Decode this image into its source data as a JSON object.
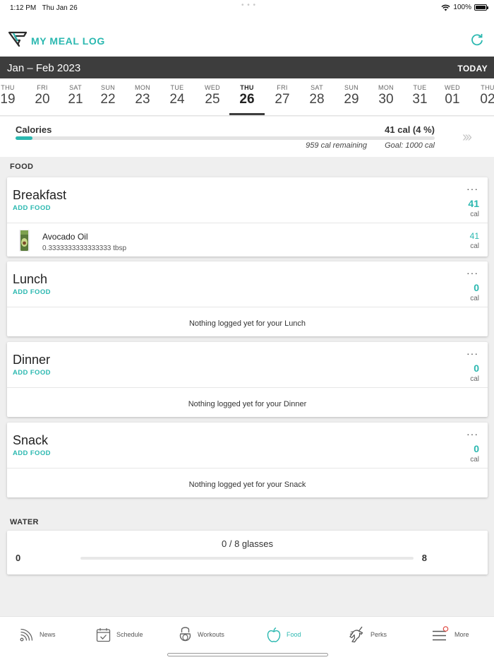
{
  "status_bar": {
    "time": "1:12 PM",
    "date": "Thu Jan 26",
    "battery": "100%"
  },
  "header": {
    "title": "MY MEAL LOG",
    "logo_icon": "brand-logo-icon",
    "refresh_icon": "refresh-icon"
  },
  "calendar": {
    "month_range": "Jan – Feb 2023",
    "today_label": "TODAY",
    "days": [
      {
        "dow": "THU",
        "num": "19"
      },
      {
        "dow": "FRI",
        "num": "20"
      },
      {
        "dow": "SAT",
        "num": "21"
      },
      {
        "dow": "SUN",
        "num": "22"
      },
      {
        "dow": "MON",
        "num": "23"
      },
      {
        "dow": "TUE",
        "num": "24"
      },
      {
        "dow": "WED",
        "num": "25"
      },
      {
        "dow": "THU",
        "num": "26"
      },
      {
        "dow": "FRI",
        "num": "27"
      },
      {
        "dow": "SAT",
        "num": "28"
      },
      {
        "dow": "SUN",
        "num": "29"
      },
      {
        "dow": "MON",
        "num": "30"
      },
      {
        "dow": "TUE",
        "num": "31"
      },
      {
        "dow": "WED",
        "num": "01"
      },
      {
        "dow": "THU",
        "num": "02"
      }
    ],
    "selected_index": 7
  },
  "calories": {
    "label": "Calories",
    "value": "41 cal (4 %)",
    "progress_fraction": 0.041,
    "remaining": "959 cal remaining",
    "goal": "Goal: 1000 cal"
  },
  "food_section": {
    "title": "FOOD",
    "add_food_label": "ADD FOOD",
    "more_label": "···",
    "cal_unit": "cal",
    "meals": [
      {
        "name": "Breakfast",
        "cal": "41",
        "items": [
          {
            "name": "Avocado Oil",
            "qty": "0.3333333333333333 tbsp",
            "cal": "41"
          }
        ]
      },
      {
        "name": "Lunch",
        "cal": "0",
        "empty": "Nothing logged yet for your Lunch"
      },
      {
        "name": "Dinner",
        "cal": "0",
        "empty": "Nothing logged yet for your Dinner"
      },
      {
        "name": "Snack",
        "cal": "0",
        "empty": "Nothing logged yet for your Snack"
      }
    ]
  },
  "water": {
    "title": "WATER",
    "glasses": "0 / 8 glasses",
    "min": "0",
    "max": "8",
    "progress_fraction": 0
  },
  "tabs": [
    {
      "label": "News",
      "icon": "news-icon"
    },
    {
      "label": "Schedule",
      "icon": "calendar-icon"
    },
    {
      "label": "Workouts",
      "icon": "kettlebell-icon"
    },
    {
      "label": "Food",
      "icon": "apple-icon",
      "active": true
    },
    {
      "label": "Perks",
      "icon": "unicorn-icon"
    },
    {
      "label": "More",
      "icon": "menu-icon"
    }
  ],
  "colors": {
    "accent": "#2bb8b0",
    "month_bar": "#3d3d3d",
    "background": "#efefef"
  }
}
